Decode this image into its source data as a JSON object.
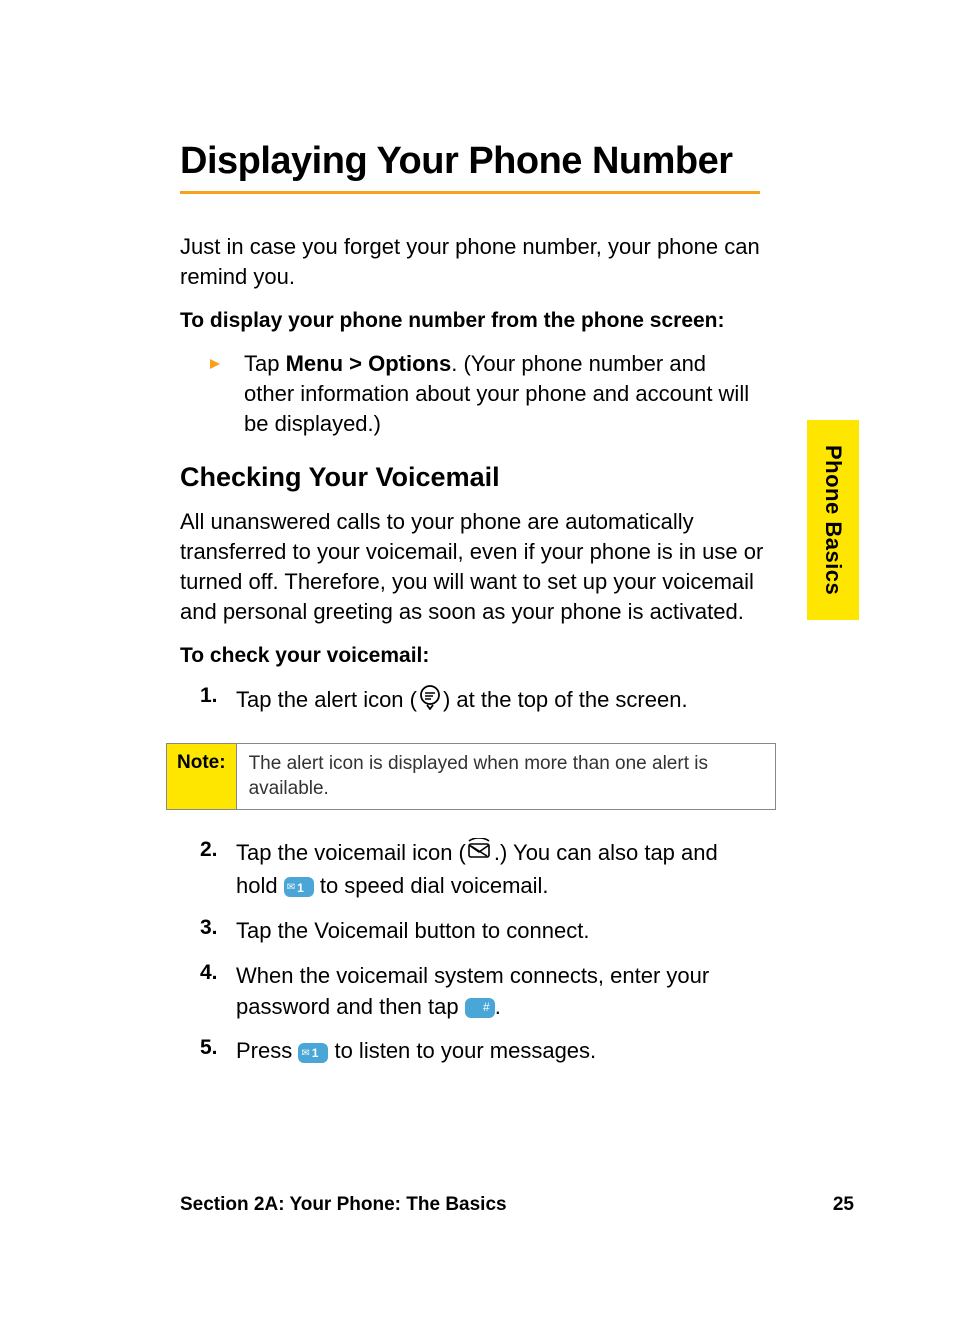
{
  "sideTab": "Phone Basics",
  "heading": "Displaying Your Phone Number",
  "intro": "Just in case you forget your phone number, your phone can remind you.",
  "toDisplay": "To display your phone number from the phone screen:",
  "bullet": {
    "pre": "Tap ",
    "bold": "Menu > Options",
    "post": ". (Your phone number and other information about your phone and account will be displayed.)"
  },
  "subHeading": "Checking Your Voicemail",
  "voicemailIntro": "All unanswered calls to your phone are automatically transferred to your voicemail, even if your phone is in use or turned off. Therefore, you will want to set up your voicemail and personal greeting as soon as your phone is activated.",
  "toCheck": "To check your voicemail:",
  "step1": {
    "num": "1.",
    "pre": "Tap the alert icon (",
    "post": ") at the top of the screen."
  },
  "note": {
    "label": "Note:",
    "text": "The alert icon is displayed when more than one alert is available."
  },
  "step2": {
    "num": "2.",
    "pre": "Tap the voicemail icon (",
    "mid": ".) You can also tap and hold ",
    "post": " to speed dial voicemail."
  },
  "step3": {
    "num": "3.",
    "text": "Tap the Voicemail button to connect."
  },
  "step4": {
    "num": "4.",
    "pre": "When the voicemail system connects, enter your password and then tap ",
    "post": "."
  },
  "step5": {
    "num": "5.",
    "pre": "Press ",
    "post": " to listen to your messages."
  },
  "key1": {
    "sym": "✉",
    "num": "1"
  },
  "keyHash": {
    "num": "#"
  },
  "footer": {
    "left": "Section 2A: Your Phone: The Basics",
    "right": "25"
  }
}
